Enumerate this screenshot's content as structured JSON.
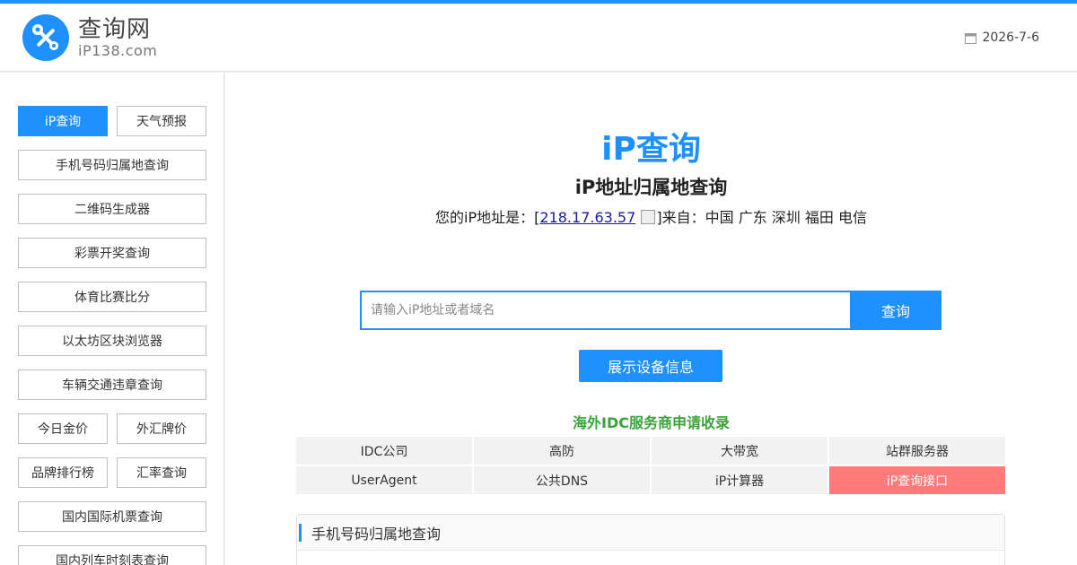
{
  "header": {
    "logo_title": "查询网",
    "logo_sub": "iP138.com",
    "date": "2026-7-6"
  },
  "sidebar": {
    "items": [
      {
        "label": "iP查询",
        "active": true
      },
      {
        "label": "天气预报"
      },
      {
        "label": "手机号码归属地查询"
      },
      {
        "label": "二维码生成器"
      },
      {
        "label": "彩票开奖查询"
      },
      {
        "label": "体育比赛比分"
      },
      {
        "label": "以太坊区块浏览器"
      },
      {
        "label": "车辆交通违章查询"
      },
      {
        "label": "今日金价"
      },
      {
        "label": "外汇牌价"
      },
      {
        "label": "品牌排行榜"
      },
      {
        "label": "汇率查询"
      },
      {
        "label": "国内国际机票查询"
      },
      {
        "label": "国内列车时刻表查询"
      }
    ]
  },
  "main": {
    "title": "iP查询",
    "subtitle": "iP地址归属地查询",
    "ip_prefix": "您的iP地址是：[",
    "ip_address": "218.17.63.57",
    "ip_suffix": "]来自：中国 广东 深圳 福田 电信",
    "search_placeholder": "请输入iP地址或者域名",
    "search_button": "查询",
    "device_button": "展示设备信息",
    "idc_title": "海外IDC服务商申请收录",
    "links": [
      {
        "label": "IDC公司"
      },
      {
        "label": "高防"
      },
      {
        "label": "大带宽"
      },
      {
        "label": "站群服务器"
      },
      {
        "label": "UserAgent"
      },
      {
        "label": "公共DNS"
      },
      {
        "label": "iP计算器"
      },
      {
        "label": "iP查询接口",
        "hot": true
      }
    ],
    "panel_title": "手机号码归属地查询"
  },
  "colors": {
    "accent": "#1e90ff",
    "green": "#3aa33a",
    "hot": "#ff7a7a"
  }
}
